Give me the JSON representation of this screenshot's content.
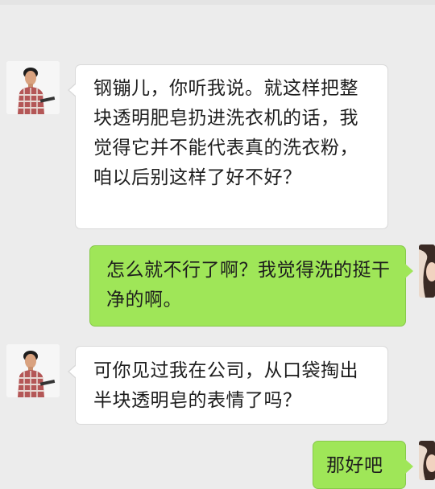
{
  "chat": {
    "messages": [
      {
        "side": "left",
        "sender_avatar": "man-plaid-shirt-avatar",
        "text": "钢镚儿，你听我说。就这样把整块透明肥皂扔进洗衣机的话，我觉得它并不能代表真的洗衣粉，咱以后别这样了好不好？"
      },
      {
        "side": "right",
        "sender_avatar": "woman-avatar",
        "text": "怎么就不行了啊？我觉得洗的挺干净的啊。"
      },
      {
        "side": "left",
        "sender_avatar": "man-plaid-shirt-avatar",
        "text": "可你见过我在公司，从口袋掏出半块透明皂的表情了吗？"
      },
      {
        "side": "right",
        "sender_avatar": "woman-avatar",
        "text": "那好吧"
      }
    ]
  },
  "colors": {
    "background": "#ececec",
    "incoming_bubble": "#ffffff",
    "outgoing_bubble": "#9fe658"
  }
}
